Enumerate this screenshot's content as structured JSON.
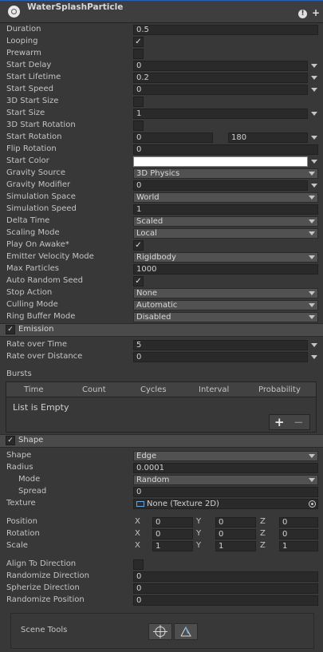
{
  "header": {
    "title": "WaterSplashParticle",
    "help": "!",
    "add": "+"
  },
  "main": [
    {
      "type": "field",
      "label": "Duration",
      "value": "0.5",
      "w": 232
    },
    {
      "type": "check",
      "label": "Looping",
      "checked": true
    },
    {
      "type": "check",
      "label": "Prewarm",
      "checked": false
    },
    {
      "type": "field",
      "label": "Start Delay",
      "value": "0",
      "w": 219,
      "arrow": true
    },
    {
      "type": "field",
      "label": "Start Lifetime",
      "value": "0.2",
      "w": 219,
      "arrow": true
    },
    {
      "type": "field",
      "label": "Start Speed",
      "value": "0",
      "w": 219,
      "arrow": true
    },
    {
      "type": "check",
      "label": "3D Start Size",
      "checked": false
    },
    {
      "type": "field",
      "label": "Start Size",
      "value": "1",
      "w": 219,
      "arrow": true
    },
    {
      "type": "check",
      "label": "3D Start Rotation",
      "checked": false
    },
    {
      "type": "range",
      "label": "Start Rotation",
      "min": "0",
      "max": "180"
    },
    {
      "type": "field",
      "label": "Flip Rotation",
      "value": "0",
      "w": 232
    },
    {
      "type": "color",
      "label": "Start Color",
      "color": "#ffffff"
    },
    {
      "type": "drop",
      "label": "Gravity Source",
      "value": "3D Physics"
    },
    {
      "type": "field",
      "label": "Gravity Modifier",
      "value": "0",
      "w": 219,
      "arrow": true
    },
    {
      "type": "drop",
      "label": "Simulation Space",
      "value": "World"
    },
    {
      "type": "field",
      "label": "Simulation Speed",
      "value": "1",
      "w": 232
    },
    {
      "type": "drop",
      "label": "Delta Time",
      "value": "Scaled"
    },
    {
      "type": "drop",
      "label": "Scaling Mode",
      "value": "Local"
    },
    {
      "type": "check",
      "label": "Play On Awake*",
      "checked": true
    },
    {
      "type": "drop",
      "label": "Emitter Velocity Mode",
      "value": "Rigidbody"
    },
    {
      "type": "field",
      "label": "Max Particles",
      "value": "1000",
      "w": 232
    },
    {
      "type": "check",
      "label": "Auto Random Seed",
      "checked": true
    },
    {
      "type": "drop",
      "label": "Stop Action",
      "value": "None"
    },
    {
      "type": "drop",
      "label": "Culling Mode",
      "value": "Automatic"
    },
    {
      "type": "drop",
      "label": "Ring Buffer Mode",
      "value": "Disabled"
    }
  ],
  "emission": {
    "title": "Emission",
    "enabled": true,
    "rate_over_time": {
      "label": "Rate over Time",
      "value": "5"
    },
    "rate_over_distance": {
      "label": "Rate over Distance",
      "value": "0"
    },
    "bursts": {
      "label": "Bursts",
      "columns": [
        "Time",
        "Count",
        "Cycles",
        "Interval",
        "Probability"
      ],
      "empty_text": "List is Empty",
      "add": "+",
      "remove": "−"
    }
  },
  "shape": {
    "title": "Shape",
    "enabled": true,
    "shape": {
      "label": "Shape",
      "value": "Edge"
    },
    "radius": {
      "label": "Radius",
      "value": "0.0001"
    },
    "mode": {
      "label": "Mode",
      "value": "Random"
    },
    "spread": {
      "label": "Spread",
      "value": "0"
    },
    "texture": {
      "label": "Texture",
      "value": "None (Texture 2D)"
    },
    "position": {
      "label": "Position",
      "x": "0",
      "y": "0",
      "z": "0"
    },
    "rotation": {
      "label": "Rotation",
      "x": "0",
      "y": "0",
      "z": "0"
    },
    "scale": {
      "label": "Scale",
      "x": "1",
      "y": "1",
      "z": "1"
    },
    "axis": {
      "x": "X",
      "y": "Y",
      "z": "Z"
    },
    "align_to_direction": {
      "label": "Align To Direction",
      "checked": false
    },
    "randomize_direction": {
      "label": "Randomize Direction",
      "value": "0"
    },
    "spherize_direction": {
      "label": "Spherize Direction",
      "value": "0"
    },
    "randomize_position": {
      "label": "Randomize Position",
      "value": "0"
    },
    "scene_tools": {
      "label": "Scene Tools"
    }
  },
  "colors": {
    "header_border": "#2a5fb8",
    "accent_texture_icon": "#6aa7e0"
  }
}
